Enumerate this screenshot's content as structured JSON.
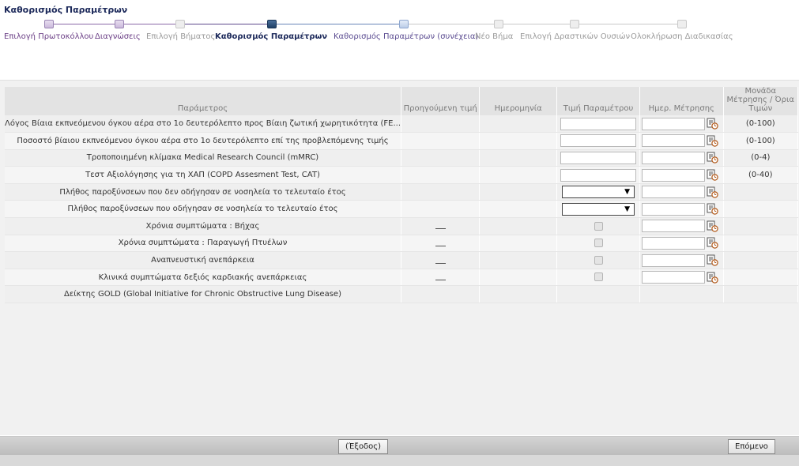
{
  "page_title": "Καθορισμός Παραμέτρων",
  "wizard": {
    "steps": [
      {
        "label": "Επιλογή Πρωτοκόλλου",
        "state": "done"
      },
      {
        "label": "Διαγνώσεις",
        "state": "done"
      },
      {
        "label": "Επιλογή Βήματος",
        "state": "fut"
      },
      {
        "label": "Καθορισμός Παραμέτρων",
        "state": "cur"
      },
      {
        "label": "Καθορισμός Παραμέτρων (συνέχεια)",
        "state": "next"
      },
      {
        "label": "Νέο Βήμα",
        "state": "fut"
      },
      {
        "label": "Επιλογή Δραστικών Ουσιών",
        "state": "fut"
      },
      {
        "label": "Ολοκλήρωση Διαδικασίας",
        "state": "fut"
      }
    ]
  },
  "grid": {
    "headers": {
      "param": "Παράμετρος",
      "prev": "Προηγούμενη τιμή",
      "date": "Ημερομηνία",
      "value": "Τιμή Παραμέτρου",
      "meas_date": "Ημερ. Μέτρησης",
      "unit": "Μονάδα Μέτρησης / Όρια Τιμών"
    },
    "rows": [
      {
        "param": "Λόγος Βίαια εκπνεόμενου όγκου αέρα στο 1ο δευτερόλεπτο προς Βίαιη ζωτική χωρητικότητα (FE...",
        "prev": "",
        "input": "text",
        "has_meas": true,
        "unit": "(0-100)"
      },
      {
        "param": "Ποσοστό βίαιου εκπνεόμενου όγκου αέρα στο 1ο δευτερόλεπτο επί της προβλεπόμενης τιμής",
        "prev": "",
        "input": "text",
        "has_meas": true,
        "unit": "(0-100)"
      },
      {
        "param": "Τροποποιημένη κλίμακα Medical Research Council (mMRC)",
        "prev": "",
        "input": "text",
        "has_meas": true,
        "unit": "(0-4)"
      },
      {
        "param": "Τεστ Αξιολόγησης για τη ΧΑΠ (COPD Assesment Test, CAT)",
        "prev": "",
        "input": "text",
        "has_meas": true,
        "unit": "(0-40)"
      },
      {
        "param": "Πλήθος παροξύνσεων που δεν οδήγησαν σε νοσηλεία το τελευταίο έτος",
        "prev": "",
        "input": "select",
        "has_meas": true,
        "unit": ""
      },
      {
        "param": "Πλήθος παροξύνσεων που οδήγησαν σε νοσηλεία το τελευταίο έτος",
        "prev": "",
        "input": "select",
        "has_meas": true,
        "unit": ""
      },
      {
        "param": "Χρόνια συμπτώματα : Βήχας",
        "prev": "dash",
        "input": "check",
        "has_meas": true,
        "unit": ""
      },
      {
        "param": "Χρόνια συμπτώματα : Παραγωγή Πτυέλων",
        "prev": "dash",
        "input": "check",
        "has_meas": true,
        "unit": ""
      },
      {
        "param": "Αναπνευστική ανεπάρκεια",
        "prev": "dash",
        "input": "check",
        "has_meas": true,
        "unit": ""
      },
      {
        "param": "Κλινικά συμπτώματα δεξιός καρδιακής ανεπάρκειας",
        "prev": "dash",
        "input": "check",
        "has_meas": true,
        "unit": ""
      },
      {
        "param": "Δείκτης GOLD (Global Initiative for Chronic Obstructive Lung Disease)",
        "prev": "",
        "input": "none",
        "has_meas": false,
        "unit": ""
      }
    ]
  },
  "footer": {
    "exit_label": "(Έξοδος)",
    "next_label": "Επόμενο"
  }
}
